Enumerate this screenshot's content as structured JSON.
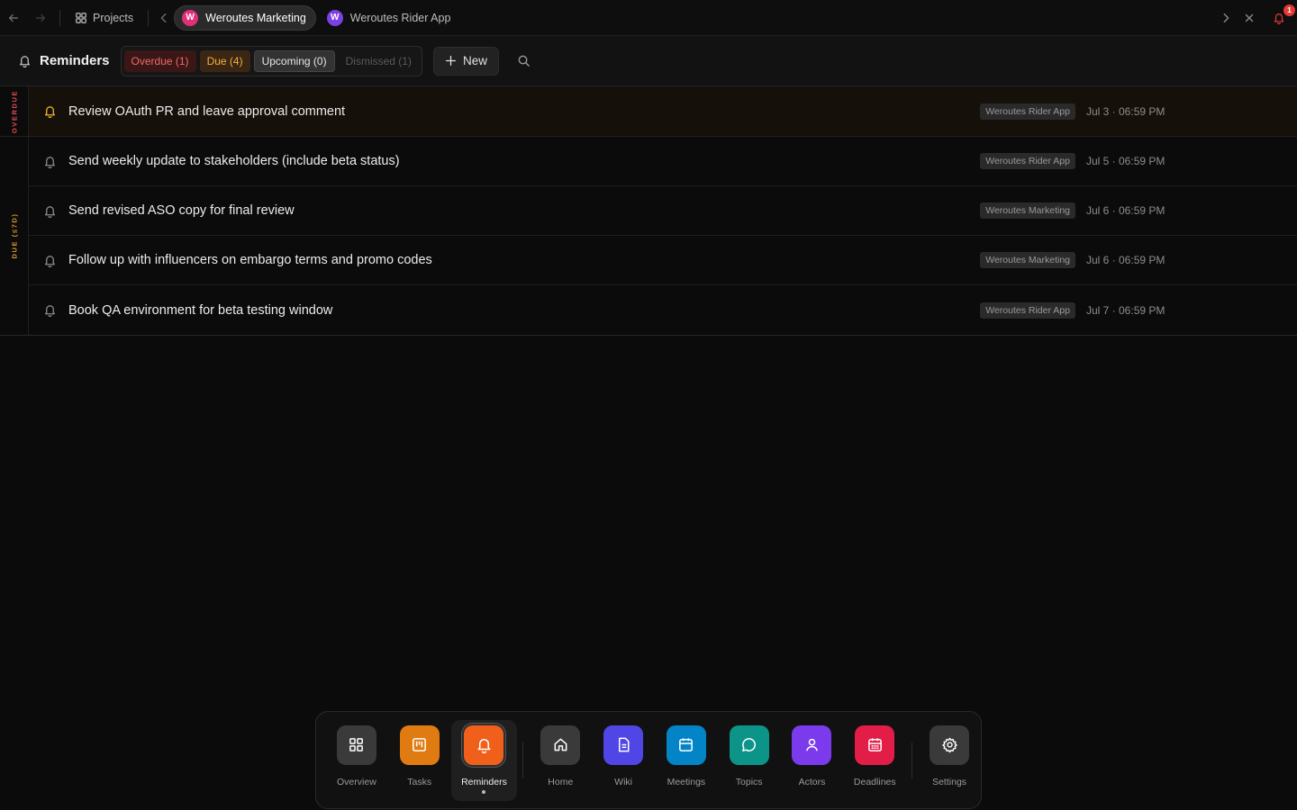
{
  "topbar": {
    "projects_label": "Projects",
    "tabs": [
      {
        "initial": "W",
        "label": "Weroutes Marketing",
        "color": "#e0307a",
        "active": true
      },
      {
        "initial": "W",
        "label": "Weroutes Rider App",
        "color": "#7b3fe4",
        "active": false
      }
    ],
    "notification_count": "1"
  },
  "header": {
    "title": "Reminders",
    "filters": {
      "overdue": "Overdue (1)",
      "due": "Due (4)",
      "upcoming": "Upcoming (0)",
      "dismissed": "Dismissed (1)"
    },
    "new_label": "New"
  },
  "groups": {
    "overdue": {
      "label": "OVERDUE",
      "rows": [
        {
          "title": "Review OAuth PR and leave approval comment",
          "project": "Weroutes Rider App",
          "date": "Jul 3 · 06:59 PM"
        }
      ]
    },
    "due": {
      "label": "DUE (≤7D)",
      "rows": [
        {
          "title": "Send weekly update to stakeholders (include beta status)",
          "project": "Weroutes Rider App",
          "date": "Jul 5 · 06:59 PM"
        },
        {
          "title": "Send revised ASO copy for final review",
          "project": "Weroutes Marketing",
          "date": "Jul 6 · 06:59 PM"
        },
        {
          "title": "Follow up with influencers on embargo terms and promo codes",
          "project": "Weroutes Marketing",
          "date": "Jul 6 · 06:59 PM"
        },
        {
          "title": "Book QA environment for beta testing window",
          "project": "Weroutes Rider App",
          "date": "Jul 7 · 06:59 PM"
        }
      ]
    }
  },
  "dock": {
    "overview": "Overview",
    "tasks": "Tasks",
    "reminders": "Reminders",
    "home": "Home",
    "wiki": "Wiki",
    "meetings": "Meetings",
    "topics": "Topics",
    "actors": "Actors",
    "deadlines": "Deadlines",
    "settings": "Settings"
  },
  "colors": {
    "tasks": "#e07b12",
    "reminders": "#f0601a",
    "wiki": "#4f46e5",
    "meetings": "#0284c7",
    "topics": "#0d9488",
    "actors": "#7c3aed",
    "deadlines": "#e11d48",
    "neutral": "#3a3a3a"
  }
}
